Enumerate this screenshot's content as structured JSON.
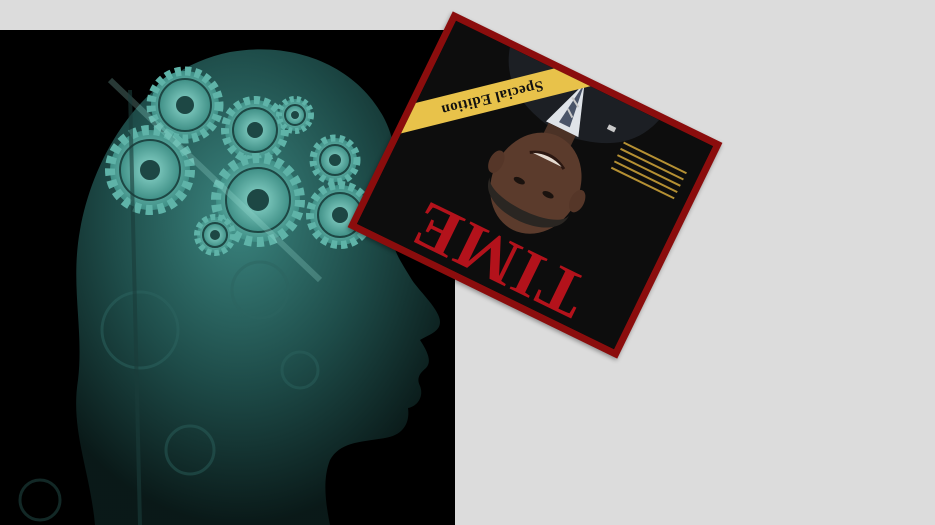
{
  "scene": {
    "background_color": "#dcdcdc",
    "head_panel": {
      "description_icon": "gears-head-icon",
      "gear_color": "#5fb3a8"
    },
    "magazine": {
      "masthead": "TIME",
      "edition_banner": "Special Edition",
      "border_color": "#8b0d0d",
      "masthead_color": "#b3121b",
      "banner_color": "#e8c24a"
    }
  }
}
